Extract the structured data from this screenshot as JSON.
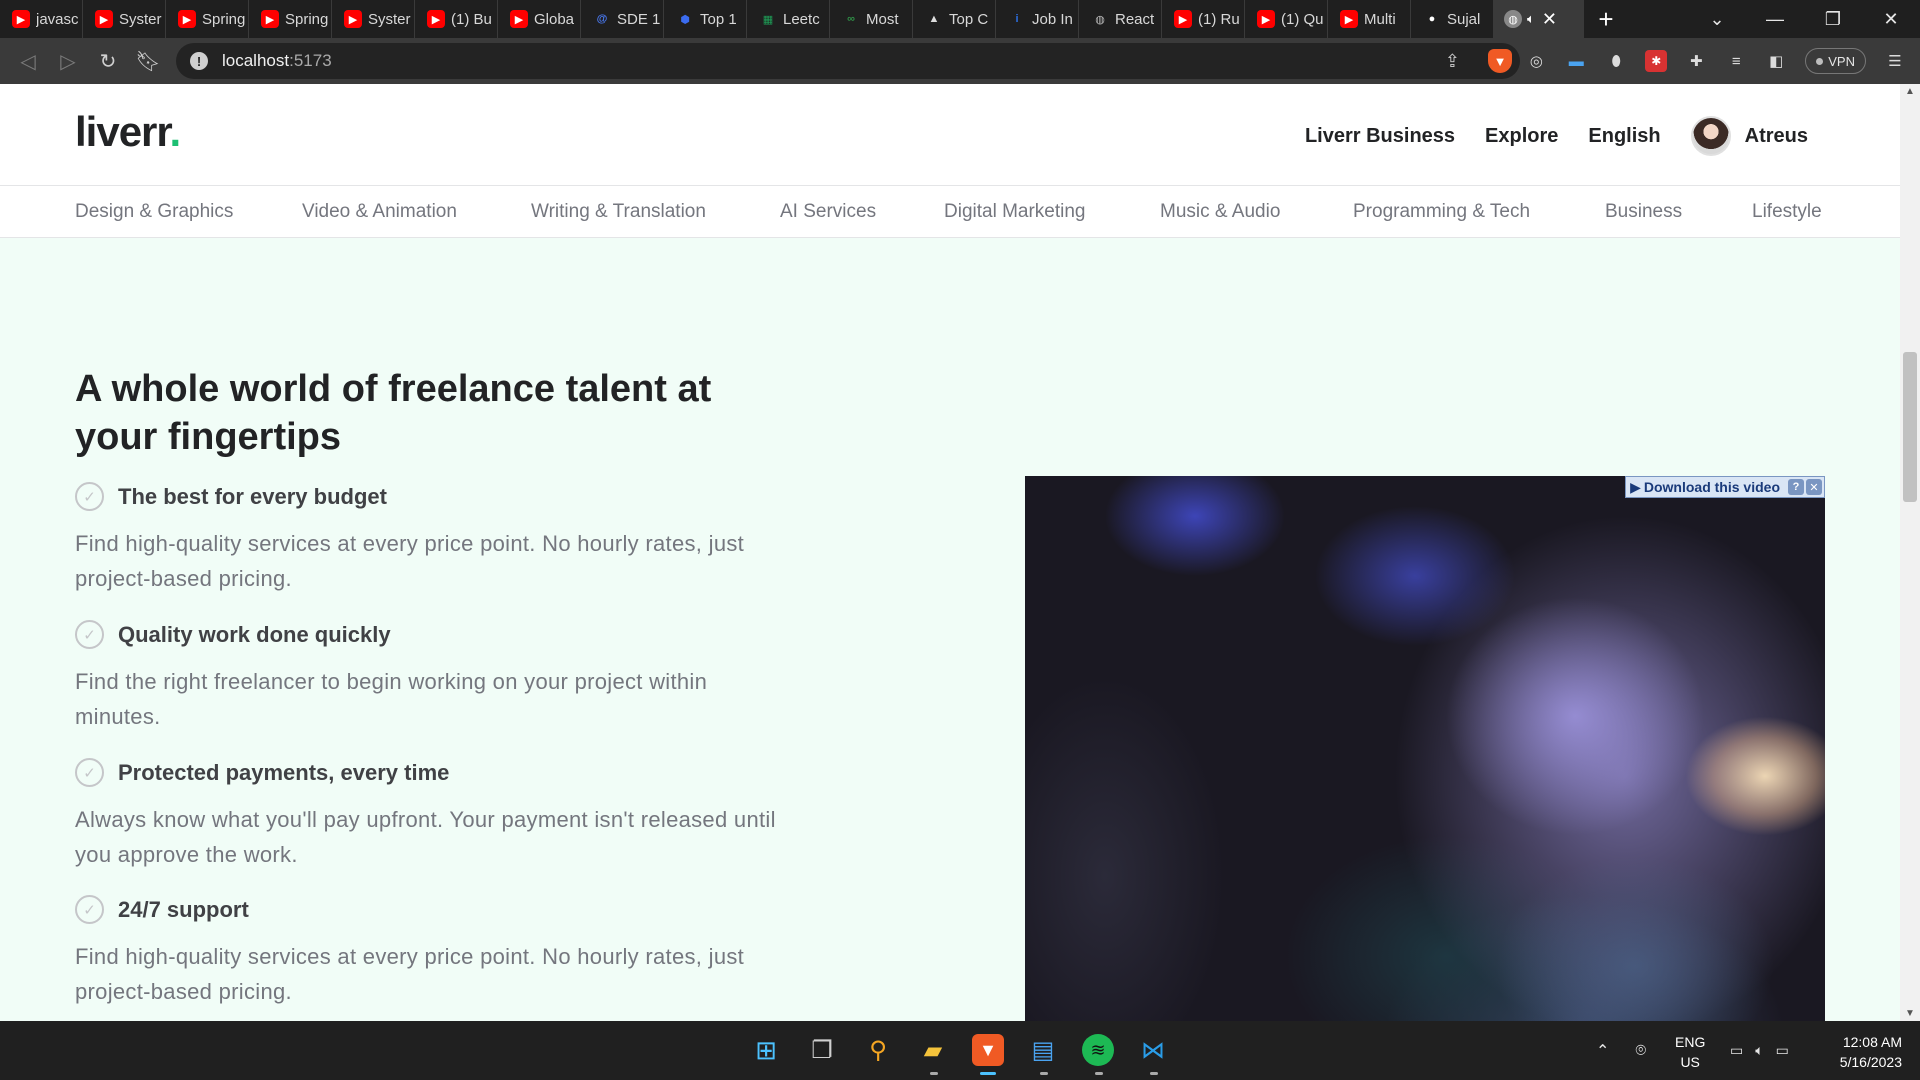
{
  "browser": {
    "tabs": [
      {
        "title": "javasc",
        "icon": "youtube-icon",
        "color": "#ff0000"
      },
      {
        "title": "Syster",
        "icon": "youtube-icon",
        "color": "#ff0000"
      },
      {
        "title": "Spring",
        "icon": "youtube-icon",
        "color": "#ff0000"
      },
      {
        "title": "Spring",
        "icon": "youtube-icon",
        "color": "#ff0000"
      },
      {
        "title": "Syster",
        "icon": "youtube-icon",
        "color": "#ff0000"
      },
      {
        "title": "(1) Bu",
        "icon": "youtube-icon",
        "color": "#ff0000"
      },
      {
        "title": "Globa",
        "icon": "youtube-icon",
        "color": "#ff0000"
      },
      {
        "title": "SDE 1",
        "icon": "at-icon",
        "color": "#4a7bf5"
      },
      {
        "title": "Top 1",
        "icon": "hexagon-icon",
        "color": "#3b6cf0"
      },
      {
        "title": "Leetc",
        "icon": "sheets-icon",
        "color": "#1e9e57"
      },
      {
        "title": "Most",
        "icon": "gfg-icon",
        "color": "#2f8d46"
      },
      {
        "title": "Top C",
        "icon": "mountain-icon",
        "color": "#dddddd"
      },
      {
        "title": "Job In",
        "icon": "info-icon",
        "color": "#2b6ee0"
      },
      {
        "title": "React",
        "icon": "globe-icon",
        "color": "#bbbbbb"
      },
      {
        "title": "(1) Ru",
        "icon": "youtube-icon",
        "color": "#ff0000"
      },
      {
        "title": "(1) Qu",
        "icon": "youtube-icon",
        "color": "#ff0000"
      },
      {
        "title": "Multi",
        "icon": "youtube-icon",
        "color": "#ff0000"
      },
      {
        "title": "Sujal",
        "icon": "github-icon",
        "color": "#ffffff"
      }
    ],
    "url_host": "localhost",
    "url_port": ":5173",
    "vpn_label": "VPN"
  },
  "nav": {
    "logo_text": "liverr",
    "logo_dot": ".",
    "links": [
      "Liverr Business",
      "Explore",
      "English"
    ],
    "username": "Atreus"
  },
  "categories": [
    "Design & Graphics",
    "Video & Animation",
    "Writing & Translation",
    "AI Services",
    "Digital Marketing",
    "Music & Audio",
    "Programming & Tech",
    "Business",
    "Lifestyle"
  ],
  "hero": {
    "title": "A whole world of freelance talent at your fingertips",
    "features": [
      {
        "title": "The best for every budget",
        "desc": "Find high-quality services at every price point. No hourly rates, just project-based pricing."
      },
      {
        "title": "Quality work done quickly",
        "desc": "Find the right freelancer to begin working on your project within minutes."
      },
      {
        "title": "Protected payments, every time",
        "desc": "Always know what you'll pay upfront. Your payment isn't released until you approve the work."
      },
      {
        "title": "24/7 support",
        "desc": "Find high-quality services at every price point. No hourly rates, just project-based pricing."
      }
    ],
    "video_overlay": "Download this video"
  },
  "taskbar": {
    "lang_top": "ENG",
    "lang_bottom": "US",
    "time": "12:08 AM",
    "date": "5/16/2023"
  },
  "colors": {
    "brand_green": "#1dbf73",
    "hero_bg": "#f1fdf7",
    "text_dark": "#222325",
    "text_muted": "#74767e"
  }
}
